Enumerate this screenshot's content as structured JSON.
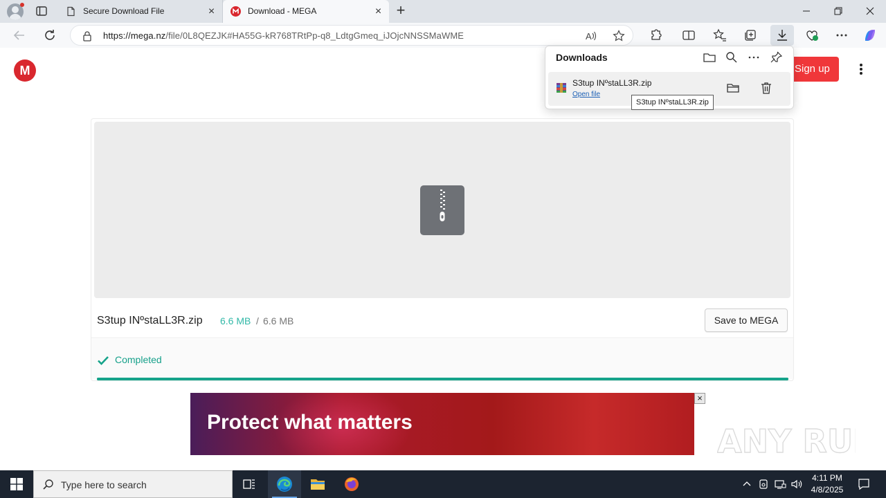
{
  "browser": {
    "tabs": [
      {
        "title": "Secure Download File",
        "active": false
      },
      {
        "title": "Download - MEGA",
        "active": true
      }
    ],
    "url": {
      "host": "https://mega.nz",
      "path": "/file/0L8QEZJK#HA55G-kR768TRtPp-q8_LdtgGmeq_iJOjcNNSSMaWME"
    }
  },
  "page": {
    "logo_letter": "M",
    "signup_label": "Sign up",
    "file_name": "S3tup INºstaLL3R.zip",
    "size_done": "6.6 MB",
    "size_sep": "/",
    "size_total": "6.6 MB",
    "save_label": "Save to MEGA",
    "status": "Completed",
    "progress_percent": 100,
    "ad_text": "Protect what matters",
    "ad_close": "×"
  },
  "downloads": {
    "title": "Downloads",
    "item_name": "S3tup INºstaLL3R.zip",
    "open_label": "Open file",
    "tooltip": "S3tup INºstaLL3R.zip"
  },
  "watermark": "ANY RUN",
  "taskbar": {
    "search_placeholder": "Type here to search",
    "time": "4:11 PM",
    "date": "4/8/2025"
  },
  "colors": {
    "mega_red": "#d9272e",
    "signup_red": "#f0373a",
    "complete_green": "#16a38a"
  }
}
